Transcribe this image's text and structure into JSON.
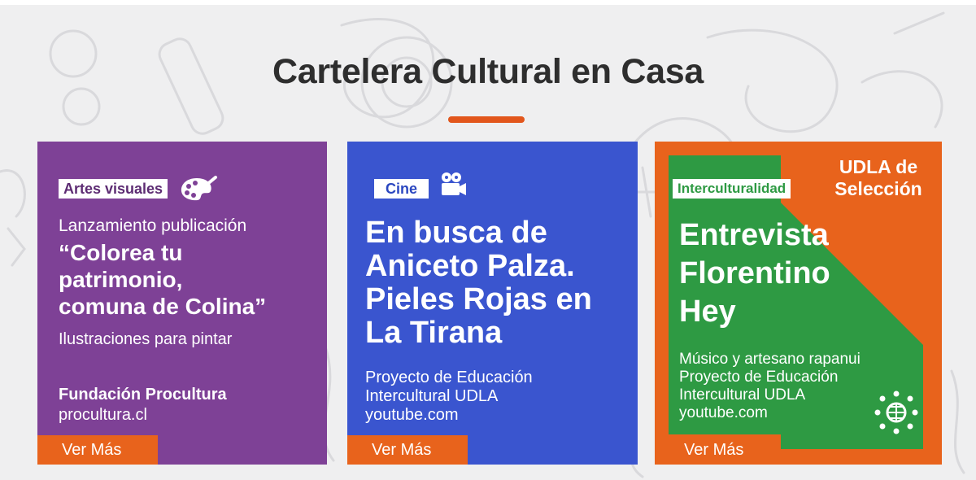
{
  "page": {
    "title": "Cartelera Cultural en Casa"
  },
  "colors": {
    "accent": "#e2561c",
    "purple": "#7e4196",
    "blue": "#3a55cf",
    "orange": "#e8631c",
    "green": "#2e9a43"
  },
  "cards": [
    {
      "tag": "Artes visuales",
      "icon": "palette-icon",
      "lead": "Lanzamiento publicación",
      "headline_lines": [
        "“Colorea tu",
        "patrimonio,",
        "comuna de Colina”"
      ],
      "subtitle": "Ilustraciones para pintar",
      "organization": "Fundación Procultura",
      "website": "procultura.cl",
      "cta": "Ver Más"
    },
    {
      "tag": "Cine",
      "icon": "movie-camera-icon",
      "headline_lines": [
        "En busca de",
        "Aniceto Palza.",
        "Pieles Rojas en",
        "La Tirana"
      ],
      "info_lines": [
        "Proyecto de Educación",
        "Intercultural UDLA",
        "youtube.com"
      ],
      "cta": "Ver Más"
    },
    {
      "tag": "Interculturalidad",
      "badge_lines": [
        "UDLA de",
        "Selección"
      ],
      "headline_lines": [
        "Entrevista",
        "Florentino",
        "Hey"
      ],
      "info_lines": [
        "Músico y artesano rapanui",
        "Proyecto de Educación",
        "Intercultural UDLA",
        "youtube.com"
      ],
      "icon": "globe-network-icon",
      "cta": "Ver Más"
    }
  ]
}
